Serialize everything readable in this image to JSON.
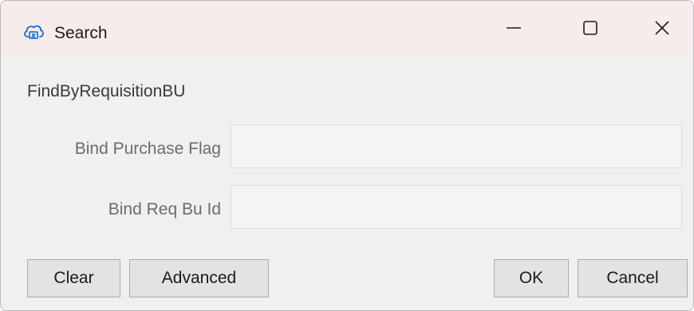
{
  "window": {
    "title": "Search",
    "icon": "cloud-search-icon",
    "controls": {
      "minimize_icon": "minimize-icon",
      "maximize_icon": "maximize-icon",
      "close_icon": "close-icon"
    }
  },
  "form": {
    "query_name": "FindByRequisitionBU",
    "fields": [
      {
        "label": "Bind Purchase Flag",
        "value": ""
      },
      {
        "label": "Bind Req Bu Id",
        "value": ""
      }
    ]
  },
  "buttons": {
    "clear": "Clear",
    "advanced": "Advanced",
    "ok": "OK",
    "cancel": "Cancel"
  },
  "colors": {
    "titlebar": "#f6ecec",
    "dialog_bg": "#f0f0f0",
    "icon_blue": "#2a72c9"
  }
}
